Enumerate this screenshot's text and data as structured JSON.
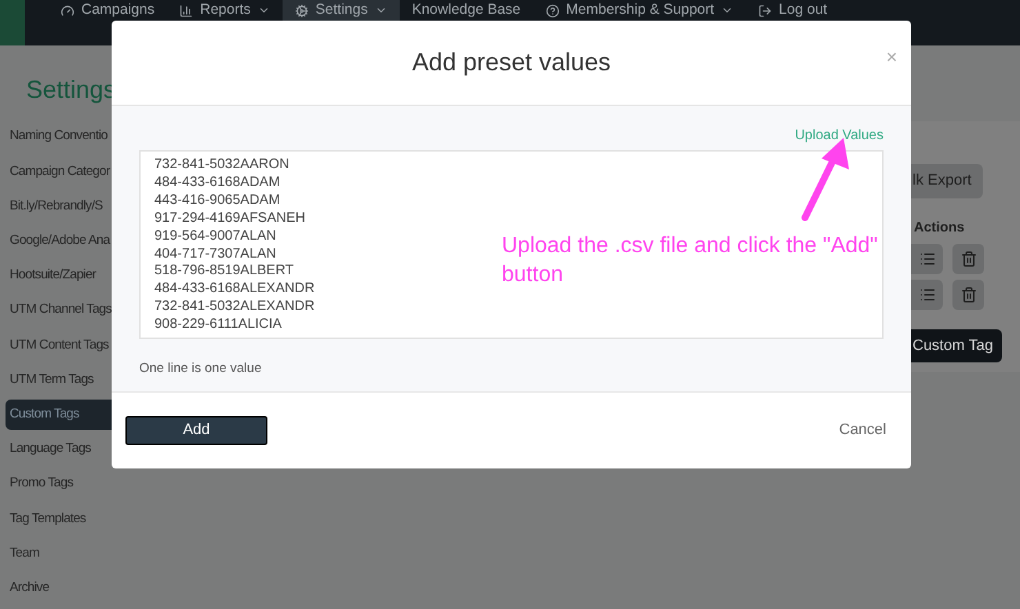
{
  "nav": {
    "items": [
      {
        "label": "Campaigns",
        "dropdown": false,
        "selected": false
      },
      {
        "label": "Reports",
        "dropdown": true,
        "selected": false
      },
      {
        "label": "Settings",
        "dropdown": true,
        "selected": true
      },
      {
        "label": "Knowledge Base",
        "dropdown": false,
        "selected": false
      },
      {
        "label": "Membership & Support",
        "dropdown": true,
        "selected": false
      },
      {
        "label": "Log out",
        "dropdown": false,
        "selected": false
      }
    ]
  },
  "page": {
    "title": "Settings"
  },
  "sidebar": {
    "items": [
      {
        "label": "Naming Conventio",
        "selected": false
      },
      {
        "label": "Campaign Categor",
        "selected": false
      },
      {
        "label": "Bit.ly/Rebrandly/S",
        "selected": false
      },
      {
        "label": "Google/Adobe Ana",
        "selected": false
      },
      {
        "label": "Hootsuite/Zapier",
        "selected": false
      },
      {
        "label": "UTM Channel Tags",
        "selected": false
      },
      {
        "label": "UTM Content Tags",
        "selected": false
      },
      {
        "label": "UTM Term Tags",
        "selected": false
      },
      {
        "label": "Custom Tags",
        "selected": true
      },
      {
        "label": "Language Tags",
        "selected": false
      },
      {
        "label": "Promo Tags",
        "selected": false
      },
      {
        "label": "Tag Templates",
        "selected": false
      },
      {
        "label": "Team",
        "selected": false
      },
      {
        "label": "Archive",
        "selected": false
      }
    ]
  },
  "panel": {
    "export_button": "lk Export",
    "actions_header": "Actions",
    "add_button": "Custom Tag"
  },
  "modal": {
    "title": "Add preset values",
    "close": "×",
    "upload_link": "Upload Values",
    "values": [
      "732-841-5032AARON",
      "484-433-6168ADAM",
      "443-416-9065ADAM",
      "917-294-4169AFSANEH",
      "919-564-9007ALAN",
      "404-717-7307ALAN",
      "518-796-8519ALBERT",
      "484-433-6168ALEXANDR",
      "732-841-5032ALEXANDR",
      "908-229-6111ALICIA"
    ],
    "hint": "One line is one value",
    "primary_button": "Add",
    "cancel": "Cancel"
  },
  "annotation": {
    "text": "Upload the .csv file and click the \"Add\" button"
  }
}
